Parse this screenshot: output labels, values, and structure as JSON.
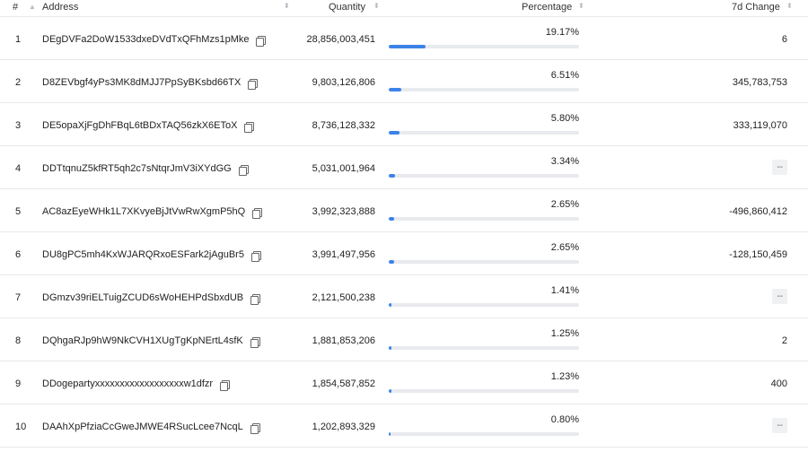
{
  "header": {
    "idx_label": "#",
    "sort_up_icon": "▲",
    "address_label": "Address",
    "quantity_label": "Quantity",
    "percentage_label": "Percentage",
    "change_label": "7d Change",
    "sort_icon": "⬍"
  },
  "colors": {
    "bar_fill": "#3b83e8",
    "bar_track": "#e8eaee"
  },
  "rows": [
    {
      "rank": "1",
      "address": "DEgDVFa2DoW1533dxeDVdTxQFhMzs1pMke",
      "quantity": "28,856,003,451",
      "percentage": "19.17%",
      "pct_value": 19.17,
      "change": "6"
    },
    {
      "rank": "2",
      "address": "D8ZEVbgf4yPs3MK8dMJJ7PpSyBKsbd66TX",
      "quantity": "9,803,126,806",
      "percentage": "6.51%",
      "pct_value": 6.51,
      "change": "345,783,753"
    },
    {
      "rank": "3",
      "address": "DE5opaXjFgDhFBqL6tBDxTAQ56zkX6EToX",
      "quantity": "8,736,128,332",
      "percentage": "5.80%",
      "pct_value": 5.8,
      "change": "333,119,070"
    },
    {
      "rank": "4",
      "address": "DDTtqnuZ5kfRT5qh2c7sNtqrJmV3iXYdGG",
      "quantity": "5,031,001,964",
      "percentage": "3.34%",
      "pct_value": 3.34,
      "change": "--"
    },
    {
      "rank": "5",
      "address": "AC8azEyeWHk1L7XKvyeBjJtVwRwXgmP5hQ",
      "quantity": "3,992,323,888",
      "percentage": "2.65%",
      "pct_value": 2.65,
      "change": "-496,860,412"
    },
    {
      "rank": "6",
      "address": "DU8gPC5mh4KxWJARQRxoESFark2jAguBr5",
      "quantity": "3,991,497,956",
      "percentage": "2.65%",
      "pct_value": 2.65,
      "change": "-128,150,459"
    },
    {
      "rank": "7",
      "address": "DGmzv39riELTuigZCUD6sWoHEHPdSbxdUB",
      "quantity": "2,121,500,238",
      "percentage": "1.41%",
      "pct_value": 1.41,
      "change": "--"
    },
    {
      "rank": "8",
      "address": "DQhgaRJp9hW9NkCVH1XUgTgKpNErtL4sfK",
      "quantity": "1,881,853,206",
      "percentage": "1.25%",
      "pct_value": 1.25,
      "change": "2"
    },
    {
      "rank": "9",
      "address": "DDogepartyxxxxxxxxxxxxxxxxxxw1dfzr",
      "quantity": "1,854,587,852",
      "percentage": "1.23%",
      "pct_value": 1.23,
      "change": "400"
    },
    {
      "rank": "10",
      "address": "DAAhXpPfziaCcGweJMWE4RSucLcee7NcqL",
      "quantity": "1,202,893,329",
      "percentage": "0.80%",
      "pct_value": 0.8,
      "change": "--"
    }
  ]
}
